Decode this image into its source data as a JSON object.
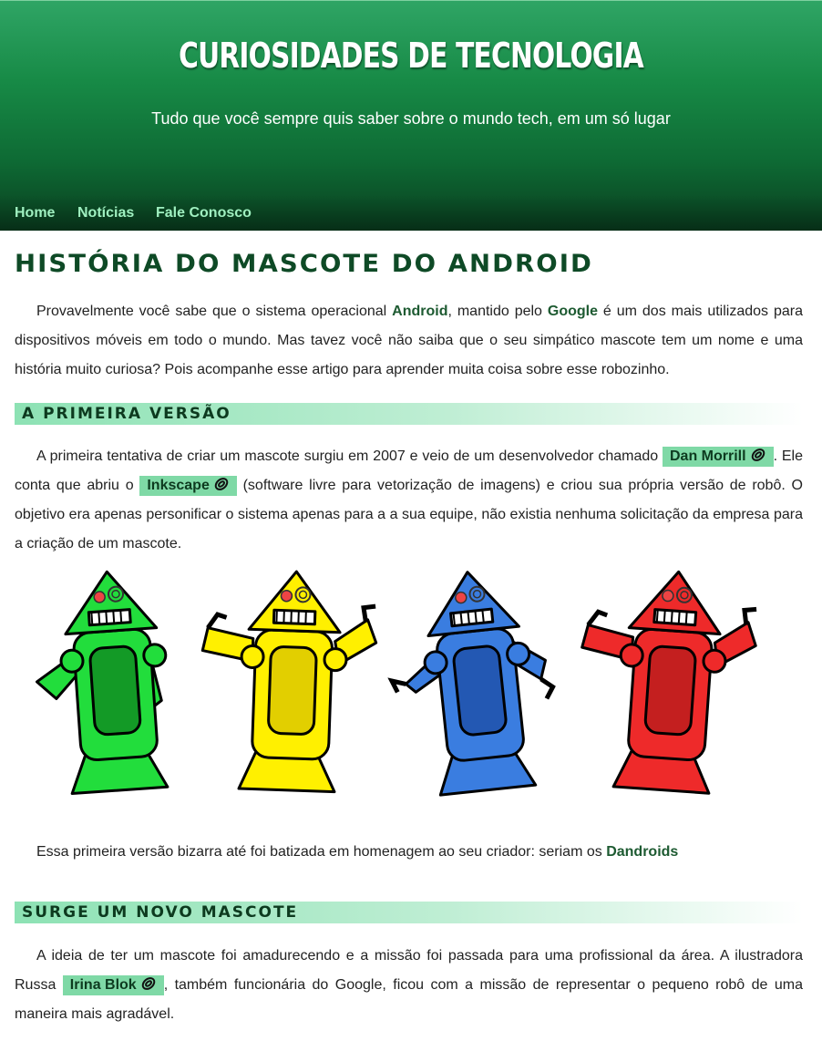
{
  "header": {
    "title": "CURIOSIDADES DE TECNOLOGIA",
    "subtitle": "Tudo que você sempre quis saber sobre o mundo tech, em um só lugar"
  },
  "nav": {
    "items": [
      "Home",
      "Notícias",
      "Fale Conosco"
    ]
  },
  "page": {
    "title": "História do mascote do Android"
  },
  "intro": {
    "t1": "Provavelmente você sabe que o sistema operacional ",
    "k1": "Android",
    "t2": ", mantido pelo ",
    "k2": "Google",
    "t3": " é um dos mais utilizados para dispositivos móveis em todo o mundo. Mas tavez você não saiba que o seu simpático mascote tem um nome e uma história muito curiosa? Pois acompanhe esse artigo para aprender muita coisa sobre esse robozinho."
  },
  "section1": {
    "heading": "A primeira versão",
    "p1": {
      "t1": "A primeira tentativa de criar um mascote surgiu em 2007 e veio de um desenvolvedor chamado ",
      "link1": "Dan Morrill",
      "t2": ". Ele conta que abriu o ",
      "link2": "Inkscape",
      "t3": " (software livre para vetorização de imagens) e criou sua própria versão de robô. O objetivo era apenas personificar o sistema apenas para a a sua equipe, não existia nenhuma solicitação da empresa para a criação de um mascote."
    },
    "p2": {
      "t1": "Essa primeira versão bizarra até foi batizada em homenagem ao seu criador: seriam os ",
      "k1": "Dandroids"
    }
  },
  "section2": {
    "heading": "Surge um novo mascote",
    "p1": {
      "t1": "A ideia de ter um mascote foi amadurecendo e a missão foi passada para uma profissional da área. A ilustradora Russa ",
      "link1": "Irina Blok",
      "t2": ", também funcionária do Google, ficou com a missão de representar o pequeno robô de uma maneira mais agradável."
    }
  },
  "colors": {
    "header_top": "#2fa565",
    "header_bottom": "#093e1f",
    "nav_link": "#9ff0c0",
    "keyword": "#1d5a31",
    "chip_bg": "#7fd9a6",
    "heading_text": "#0d3a1f"
  },
  "robots": {
    "colors": [
      {
        "main": "#22dd3c",
        "dark": "#139a26"
      },
      {
        "main": "#fff000",
        "dark": "#e2cf00"
      },
      {
        "main": "#3a7de0",
        "dark": "#2358b3"
      },
      {
        "main": "#ee2a2a",
        "dark": "#c41f1f"
      }
    ]
  },
  "icons": {
    "link": "paperclip-icon"
  }
}
